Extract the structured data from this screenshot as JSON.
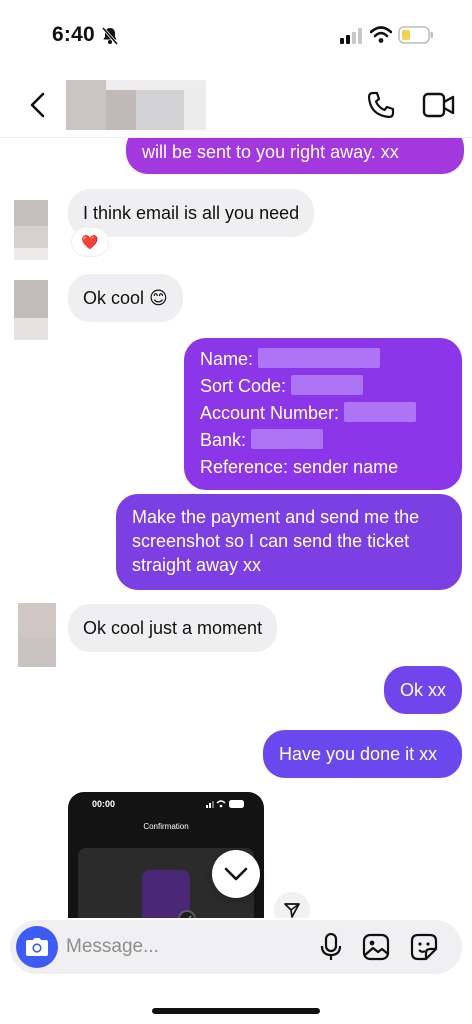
{
  "status": {
    "time": "6:40",
    "battery_color": "#f6d14a"
  },
  "header": {
    "back_icon": "chevron-left-icon",
    "call_icon": "phone-icon",
    "video_icon": "video-camera-icon"
  },
  "colors": {
    "accent": "#7b3fe4",
    "incoming_bg": "#efeff1",
    "camera": "#3e5bf5"
  },
  "messages": [
    {
      "dir": "out",
      "text": "will be sent to you right away. xx"
    },
    {
      "dir": "in",
      "text": "I think email is all you need",
      "reaction": "❤️"
    },
    {
      "dir": "in",
      "text": "Ok cool 😊"
    },
    {
      "dir": "out",
      "lines": [
        "Name:",
        "Sort Code:",
        "Account Number:",
        "Bank:",
        "Reference: sender name"
      ]
    },
    {
      "dir": "out",
      "lines": [
        "Make the payment and send me the",
        "screenshot so I can send the ticket",
        "straight away xx"
      ]
    },
    {
      "dir": "in",
      "text": "Ok cool just a moment"
    },
    {
      "dir": "out",
      "text": "Ok xx"
    },
    {
      "dir": "out",
      "text": "Have you done it xx"
    }
  ],
  "shared_screenshot": {
    "time": "00:00",
    "title": "Confirmation"
  },
  "composer": {
    "placeholder": "Message..."
  }
}
